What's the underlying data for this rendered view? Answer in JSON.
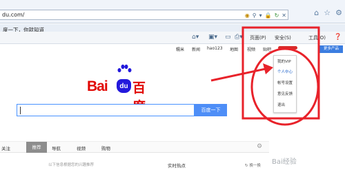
{
  "browser": {
    "url": "du.com/",
    "tab_title": "度一下，你就知道",
    "commands": [
      "页面(P)",
      "安全(S)",
      "工具(O)"
    ]
  },
  "baidu": {
    "nav": [
      "糯米",
      "新闻",
      "hao123",
      "地图",
      "视频",
      "贴吧"
    ],
    "more_label": "更多产品",
    "dropdown": [
      "我的VIP",
      "个人中心",
      "帐号设置",
      "意见反馈",
      "退出"
    ],
    "logo": {
      "latin": "Bai",
      "du": "du",
      "cn": "百度"
    },
    "search_button": "百度一下",
    "feed_tabs": [
      "关注",
      "推荐",
      "导航",
      "视频",
      "购物"
    ],
    "tip": "以下信息根据您的兴趣推荐",
    "hot_title": "实时热点",
    "refresh_label": "换一换"
  },
  "watermark": "Bai经验",
  "colors": {
    "baidu_red": "#e10602",
    "baidu_blue": "#2319dc",
    "annotation_red": "#e8222a"
  }
}
